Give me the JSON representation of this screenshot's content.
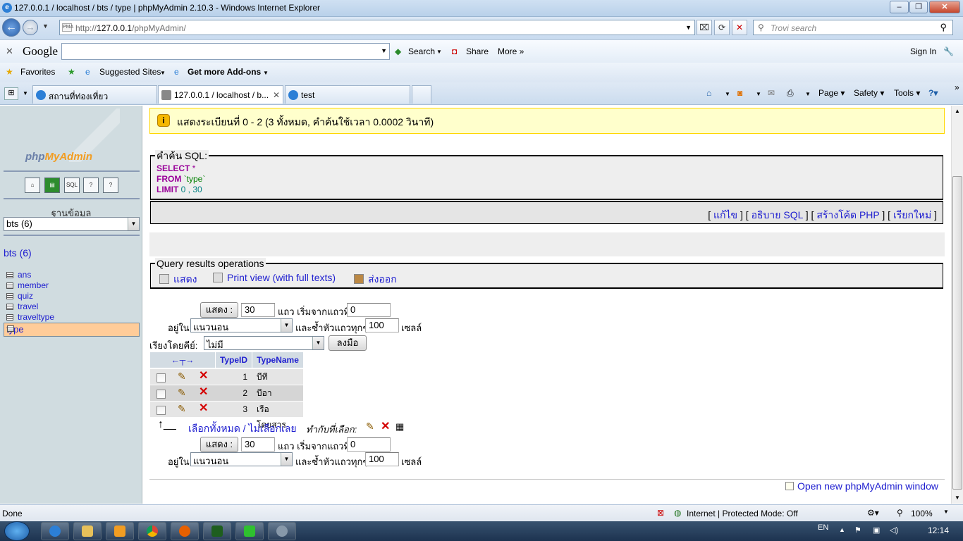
{
  "window": {
    "title": "127.0.0.1 / localhost / bts / type | phpMyAdmin 2.10.3 - Windows Internet Explorer"
  },
  "addressbar": {
    "url_prefix": "http://",
    "url_host": "127.0.0.1",
    "url_path": "/phpMyAdmin/",
    "search_placeholder": "Trovi search"
  },
  "google_toolbar": {
    "logo": "Google",
    "search": "Search",
    "share": "Share",
    "more": "More »",
    "signin": "Sign In"
  },
  "favorites_bar": {
    "favorites": "Favorites",
    "suggested": "Suggested Sites",
    "addons": "Get more Add-ons"
  },
  "tabs": [
    {
      "label": "สถานที่ท่องเที่ยว"
    },
    {
      "label": "127.0.0.1 / localhost / b..."
    },
    {
      "label": "test"
    }
  ],
  "command_bar": {
    "page": "Page",
    "safety": "Safety",
    "tools": "Tools"
  },
  "left": {
    "logo_a": "php",
    "logo_b": "MyAdmin",
    "icons": [
      "home-icon",
      "query-icon",
      "sql-icon",
      "doc-icon",
      "doc2-icon"
    ],
    "db_label": "ฐานข้อมูล",
    "db_select": "bts (6)",
    "db_title": "bts (6)",
    "tables": [
      "ans",
      "member",
      "quiz",
      "travel",
      "traveltype",
      "type"
    ]
  },
  "notice": "แสดงระเบียนที่ 0 - 2 (3 ทั้งหมด, คำค้นใช้เวลา 0.0002 วินาที)",
  "sql": {
    "legend": "คำค้น SQL:",
    "select_kw": "SELECT",
    "select_rest": " *",
    "from_kw": "FROM",
    "from_rest": " `type`",
    "limit_kw": "LIMIT",
    "limit_rest": " 0 , 30",
    "links": [
      "แก้ไข",
      "อธิบาย SQL",
      "สร้างโค้ด PHP",
      "เรียกใหม่"
    ]
  },
  "query_ops": {
    "legend": "Query results operations",
    "show": "แสดง",
    "print": "Print view (with full texts)",
    "export": "ส่งออก"
  },
  "nav": {
    "show_btn": "แสดง :",
    "rows": "30",
    "rows_label": "แถว เริ่มจากแถวที่",
    "start": "0",
    "in_label": "อยู่ใน",
    "mode": "แนวนอน",
    "repeat_label": "และซ้ำหัวแถวทุกๆ",
    "repeat": "100",
    "cells_label": "เซลล์",
    "sort_label": "เรียงโดยคีย์:",
    "sort_value": "ไม่มี",
    "go_btn": "ลงมือ"
  },
  "table": {
    "arrows": "←┬→",
    "headers": [
      "TypeID",
      "TypeName"
    ],
    "rows": [
      {
        "id": "1",
        "name": "บีทีเอส"
      },
      {
        "id": "2",
        "name": "บีอาที"
      },
      {
        "id": "3",
        "name": "เรือโดยสาร"
      }
    ],
    "check_all": "เลือกทั้งหมด / ไม่เลือกเลย",
    "with_selected": "ทำกับที่เลือก:"
  },
  "footer_link": "Open new phpMyAdmin window",
  "status": {
    "left": "Done",
    "zone": "Internet | Protected Mode: Off",
    "zoom": "100%"
  },
  "taskbar": {
    "lang": "EN",
    "time": "12:14"
  }
}
